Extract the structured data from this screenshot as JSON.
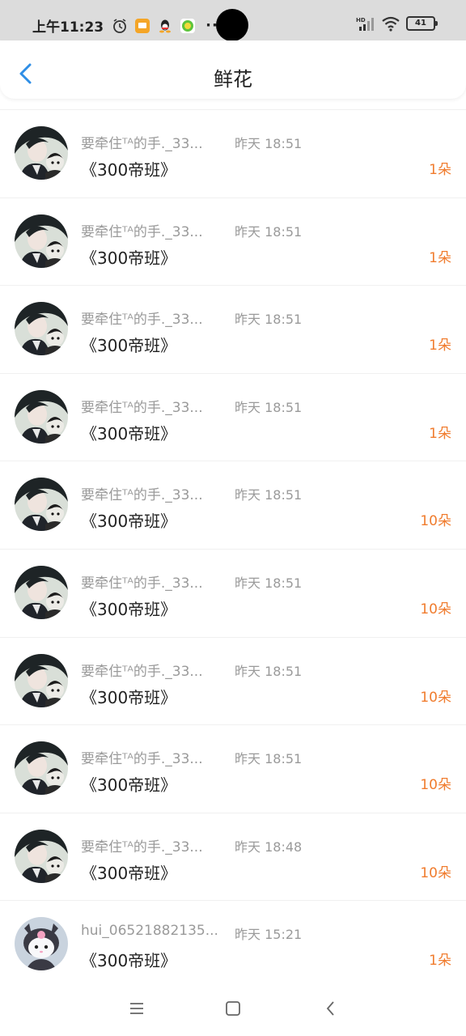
{
  "status_bar": {
    "time": "上午11:23",
    "dots": "···",
    "battery": "41",
    "icons": [
      "alarm-icon",
      "message-notification-icon",
      "qq-icon",
      "wechat-pay-icon",
      "hd-signal-icon",
      "wifi-icon",
      "battery-icon"
    ]
  },
  "header": {
    "title": "鲜花",
    "back_icon": "chevron-left-icon"
  },
  "accent_color": "#f07c2e",
  "items": [
    {
      "name": "要牵住ᵀᴬ的手._33...",
      "time": "昨天 18:51",
      "message": "《300帝班》",
      "amount": "1朵",
      "avatar": "anime-avatar"
    },
    {
      "name": "要牵住ᵀᴬ的手._33...",
      "time": "昨天 18:51",
      "message": "《300帝班》",
      "amount": "1朵",
      "avatar": "anime-avatar"
    },
    {
      "name": "要牵住ᵀᴬ的手._33...",
      "time": "昨天 18:51",
      "message": "《300帝班》",
      "amount": "1朵",
      "avatar": "anime-avatar"
    },
    {
      "name": "要牵住ᵀᴬ的手._33...",
      "time": "昨天 18:51",
      "message": "《300帝班》",
      "amount": "1朵",
      "avatar": "anime-avatar"
    },
    {
      "name": "要牵住ᵀᴬ的手._33...",
      "time": "昨天 18:51",
      "message": "《300帝班》",
      "amount": "10朵",
      "avatar": "anime-avatar"
    },
    {
      "name": "要牵住ᵀᴬ的手._33...",
      "time": "昨天 18:51",
      "message": "《300帝班》",
      "amount": "10朵",
      "avatar": "anime-avatar"
    },
    {
      "name": "要牵住ᵀᴬ的手._33...",
      "time": "昨天 18:51",
      "message": "《300帝班》",
      "amount": "10朵",
      "avatar": "anime-avatar"
    },
    {
      "name": "要牵住ᵀᴬ的手._33...",
      "time": "昨天 18:51",
      "message": "《300帝班》",
      "amount": "10朵",
      "avatar": "anime-avatar"
    },
    {
      "name": "要牵住ᵀᴬ的手._33...",
      "time": "昨天 18:48",
      "message": "《300帝班》",
      "amount": "10朵",
      "avatar": "anime-avatar"
    },
    {
      "name": "hui_06521882135...",
      "time": "昨天 15:21",
      "message": "《300帝班》",
      "amount": "1朵",
      "avatar": "kuromi-avatar"
    }
  ],
  "nav_bar": {
    "icons": [
      "menu-icon",
      "home-icon",
      "back-icon"
    ]
  }
}
